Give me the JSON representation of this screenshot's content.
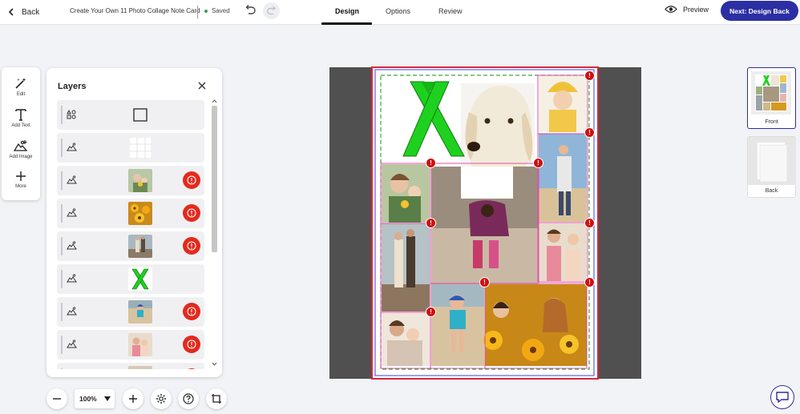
{
  "header": {
    "back_label": "Back",
    "project_title": "Create Your Own 11 Photo Collage Note Card",
    "save_status": "Saved",
    "tabs": [
      {
        "label": "Design",
        "active": true
      },
      {
        "label": "Options",
        "active": false
      },
      {
        "label": "Review",
        "active": false
      }
    ],
    "preview_label": "Preview",
    "next_label": "Next: Design Back"
  },
  "tools": [
    {
      "label": "Edit",
      "icon": "magic-wand-icon"
    },
    {
      "label": "Add Text",
      "icon": "text-t-icon"
    },
    {
      "label": "Add Image",
      "icon": "add-image-icon"
    },
    {
      "label": "More",
      "icon": "plus-icon"
    }
  ],
  "layers_panel": {
    "title": "Layers",
    "rows": [
      {
        "type": "shapes",
        "thumb": "empty-square",
        "warning": false
      },
      {
        "type": "image",
        "thumb": "grid-frame",
        "warning": false
      },
      {
        "type": "image",
        "thumb": "mother-daughter-flowers",
        "warning": true
      },
      {
        "type": "image",
        "thumb": "sunflowers",
        "warning": true
      },
      {
        "type": "image",
        "thumb": "couple-walking",
        "warning": true
      },
      {
        "type": "image",
        "thumb": "green-ribbon",
        "warning": false
      },
      {
        "type": "image",
        "thumb": "girl-beach",
        "warning": true
      },
      {
        "type": "image",
        "thumb": "mother-daughter-kitchen",
        "warning": true
      },
      {
        "type": "image",
        "thumb": "mother-child",
        "warning": true
      }
    ]
  },
  "zoom": {
    "level": "100%"
  },
  "pages": [
    {
      "label": "Front",
      "selected": true
    },
    {
      "label": "Back",
      "selected": false
    }
  ],
  "colors": {
    "accent": "#2b2fa3",
    "warning": "#e32a1d",
    "saved_dot": "#2ca24a",
    "ribbon": "#1ed11e",
    "canvas_bg": "#505050"
  }
}
